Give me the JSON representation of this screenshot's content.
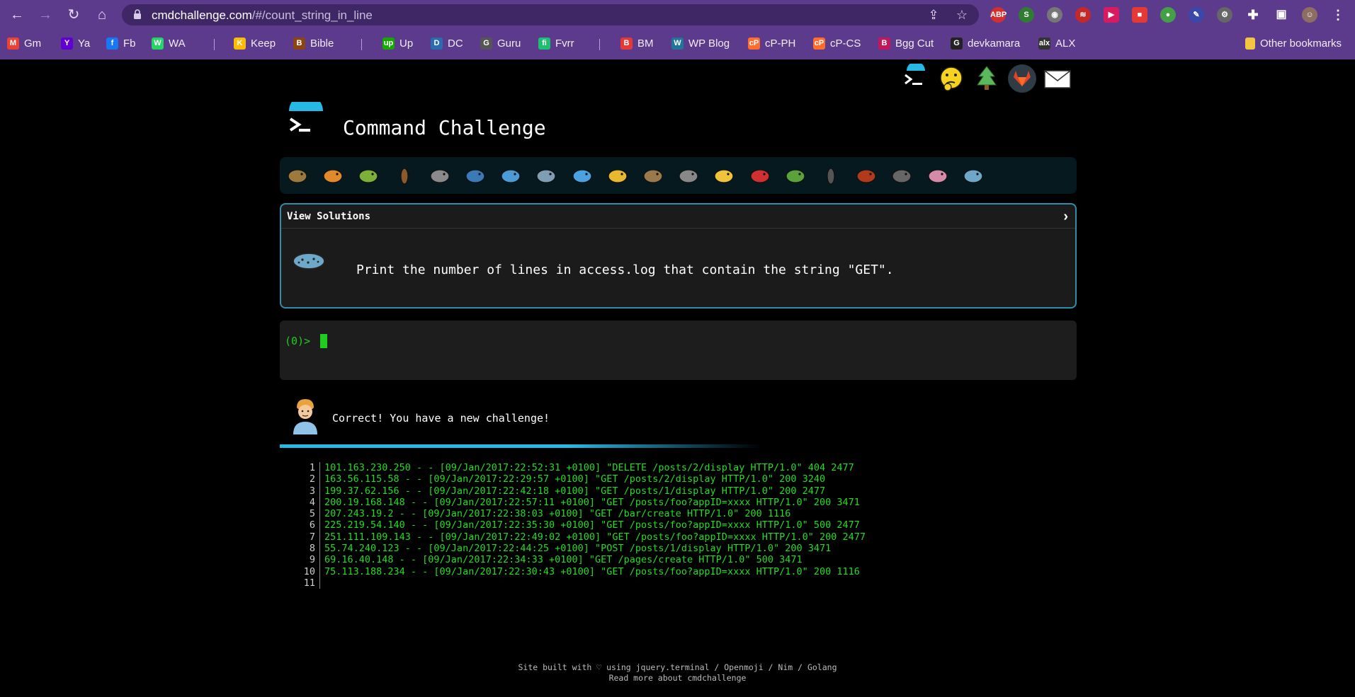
{
  "browser": {
    "url_host": "cmdchallenge.com",
    "url_path": "/#/count_string_in_line",
    "bookmarks": [
      {
        "label": "Gm",
        "color": "#ea4335",
        "glyph": "M"
      },
      {
        "label": "Ya",
        "color": "#6001d2",
        "glyph": "Y"
      },
      {
        "label": "Fb",
        "color": "#1877f2",
        "glyph": "f"
      },
      {
        "label": "WA",
        "color": "#25d366",
        "glyph": "W"
      },
      {
        "label": "Keep",
        "color": "#fbbc04",
        "glyph": "K"
      },
      {
        "label": "Bible",
        "color": "#8b4513",
        "glyph": "B"
      },
      {
        "label": "Up",
        "color": "#14a800",
        "glyph": "up"
      },
      {
        "label": "DC",
        "color": "#2b6cb0",
        "glyph": "D"
      },
      {
        "label": "Guru",
        "color": "#555555",
        "glyph": "G"
      },
      {
        "label": "Fvrr",
        "color": "#1dbf73",
        "glyph": "fi"
      },
      {
        "label": "BM",
        "color": "#e53935",
        "glyph": "B"
      },
      {
        "label": "WP Blog",
        "color": "#21759b",
        "glyph": "W"
      },
      {
        "label": "cP-PH",
        "color": "#ff6c2c",
        "glyph": "cP"
      },
      {
        "label": "cP-CS",
        "color": "#ff6c2c",
        "glyph": "cP"
      },
      {
        "label": "Bgg Cut",
        "color": "#c2185b",
        "glyph": "B"
      },
      {
        "label": "devkamara",
        "color": "#222222",
        "glyph": "G"
      },
      {
        "label": "ALX",
        "color": "#333333",
        "glyph": "alx"
      }
    ],
    "other_bookmarks": "Other bookmarks"
  },
  "page": {
    "title": "Command Challenge",
    "solutions_label": "View Solutions",
    "solutions_chevron": "›",
    "challenge_text": "Print the number of lines in access.log that contain the string \"GET\".",
    "prompt": "(0)>",
    "feedback": "Correct! You have a new challenge!",
    "progress_fraction": 0.6
  },
  "log": [
    {
      "n": "1",
      "text": "101.163.230.250 - - [09/Jan/2017:22:52:31 +0100] \"DELETE /posts/2/display HTTP/1.0\" 404 2477"
    },
    {
      "n": "2",
      "text": "163.56.115.58 - - [09/Jan/2017:22:29:57 +0100] \"GET /posts/2/display HTTP/1.0\" 200 3240"
    },
    {
      "n": "3",
      "text": "199.37.62.156 - - [09/Jan/2017:22:42:18 +0100] \"GET /posts/1/display HTTP/1.0\" 200 2477"
    },
    {
      "n": "4",
      "text": "200.19.168.148 - - [09/Jan/2017:22:57:11 +0100] \"GET /posts/foo?appID=xxxx HTTP/1.0\" 200 3471"
    },
    {
      "n": "5",
      "text": "207.243.19.2 - - [09/Jan/2017:22:38:03 +0100] \"GET /bar/create HTTP/1.0\" 200 1116"
    },
    {
      "n": "6",
      "text": "225.219.54.140 - - [09/Jan/2017:22:35:30 +0100] \"GET /posts/foo?appID=xxxx HTTP/1.0\" 500 2477"
    },
    {
      "n": "7",
      "text": "251.111.109.143 - - [09/Jan/2017:22:49:02 +0100] \"GET /posts/foo?appID=xxxx HTTP/1.0\" 200 2477"
    },
    {
      "n": "8",
      "text": "55.74.240.123 - - [09/Jan/2017:22:44:25 +0100] \"POST /posts/1/display HTTP/1.0\" 200 3471"
    },
    {
      "n": "9",
      "text": "69.16.40.148 - - [09/Jan/2017:22:34:33 +0100] \"GET /pages/create HTTP/1.0\" 500 3471"
    },
    {
      "n": "10",
      "text": "75.113.188.234 - - [09/Jan/2017:22:30:43 +0100] \"GET /posts/foo?appID=xxxx HTTP/1.0\" 200 1116"
    },
    {
      "n": "11",
      "text": ""
    }
  ],
  "footer": {
    "line1": "Site built with ♡ using jquery.terminal / Openmoji / Nim / Golang",
    "line2": "Read more about cmdchallenge"
  },
  "critters": [
    "snail-icon",
    "butterfly-icon",
    "caterpillar-icon",
    "ant-icon",
    "spider-web-icon",
    "whale-icon",
    "dolphin-icon",
    "shark-icon",
    "fish-icon",
    "tropical-fish-icon",
    "blowfish-icon",
    "wolf-icon",
    "bee-icon",
    "ladybug-icon",
    "cricket-icon",
    "spider-icon",
    "scorpion-icon",
    "fly-icon",
    "worm-icon",
    "microbe-icon"
  ],
  "colors": {
    "chrome": "#5c3a8c",
    "accent": "#27b9e6",
    "terminal_green": "#22dd22"
  }
}
